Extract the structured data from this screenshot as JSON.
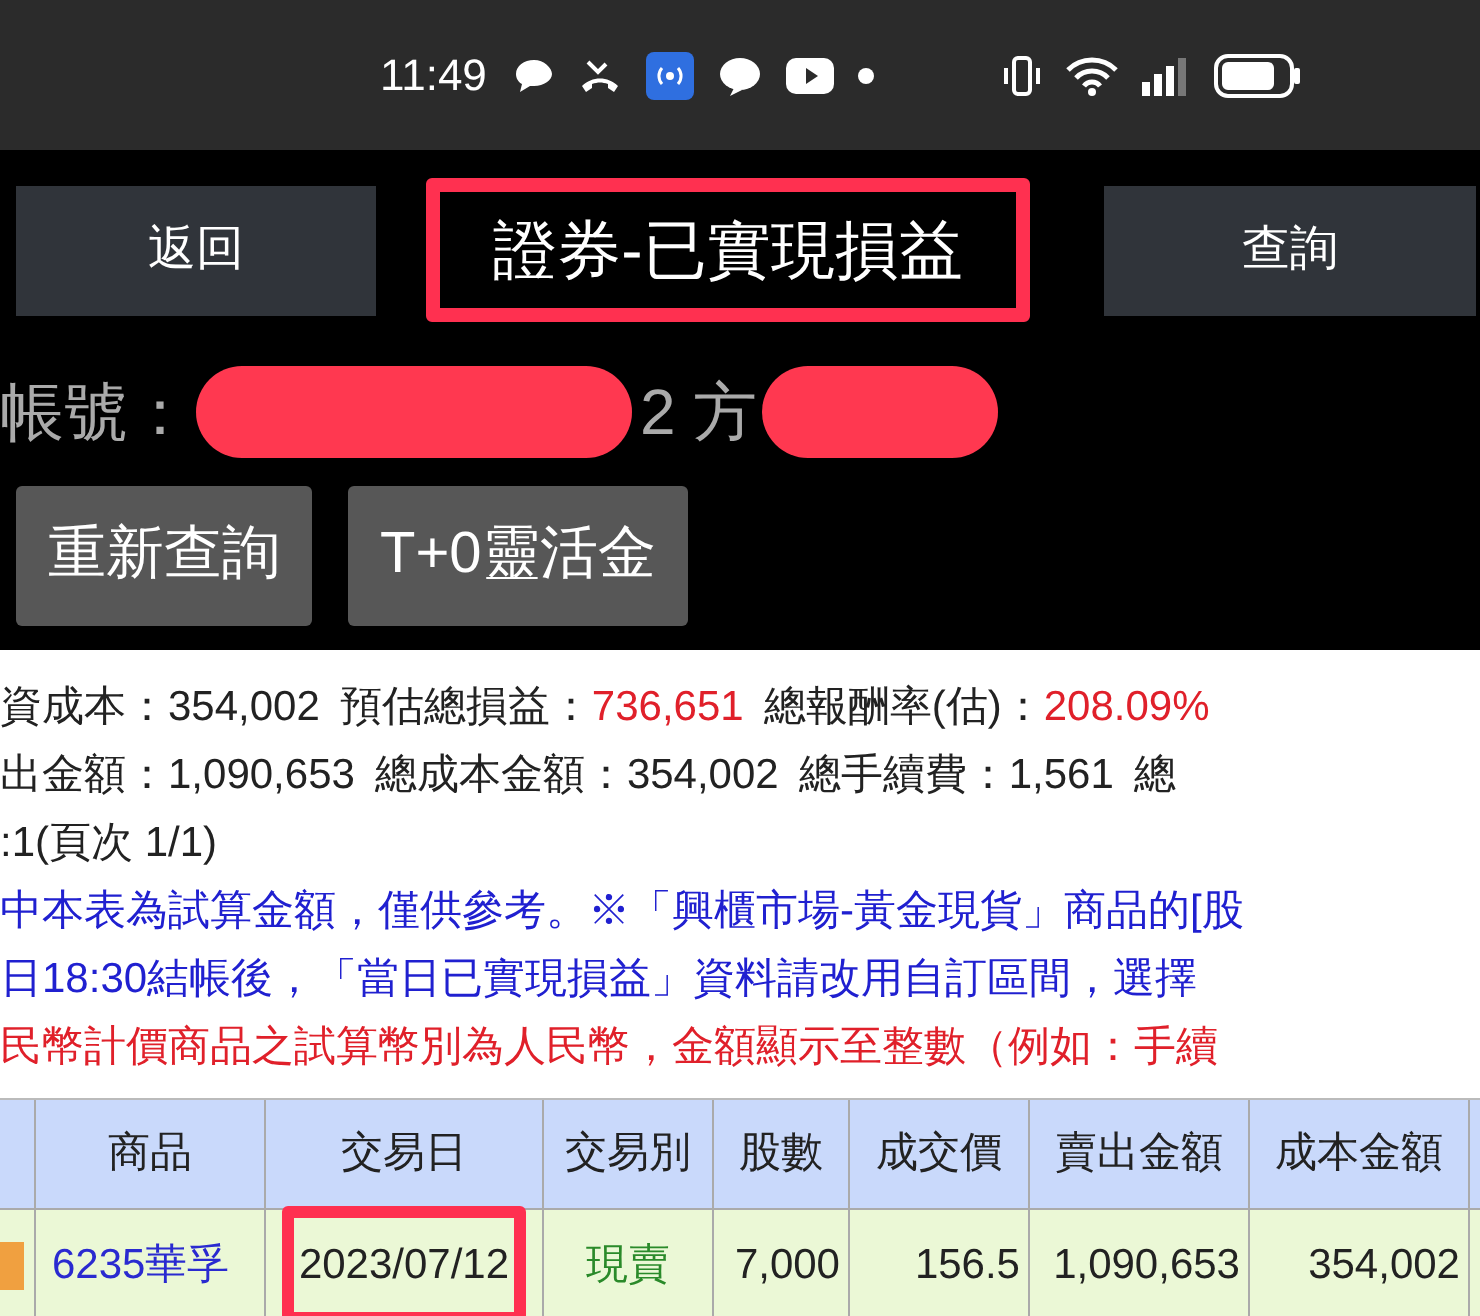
{
  "status_bar": {
    "time": "11:49"
  },
  "header": {
    "back_button": "返回",
    "title": "證券-已實現損益",
    "title_highlighted": true,
    "query_button": "查詢"
  },
  "account": {
    "label": "帳號：",
    "visible_fragment": "2 方",
    "redacted": true
  },
  "actions": [
    "重新查詢",
    "T+0靈活金"
  ],
  "summary_lines": [
    [
      {
        "text": "資成本：",
        "alert": false
      },
      {
        "text": "354,002",
        "alert": false
      },
      {
        "text": "預估總損益：",
        "alert": false
      },
      {
        "text": "736,651",
        "alert": true
      },
      {
        "text": "總報酬率(估)：",
        "alert": false
      },
      {
        "text": "208.09%",
        "alert": true
      }
    ],
    [
      {
        "text": "出金額：",
        "alert": false
      },
      {
        "text": "1,090,653",
        "alert": false
      },
      {
        "text": "總成本金額：",
        "alert": false
      },
      {
        "text": "354,002",
        "alert": false
      },
      {
        "text": "總手續費：",
        "alert": false
      },
      {
        "text": "1,561",
        "alert": false
      },
      {
        "text": "總",
        "alert": false
      }
    ],
    [
      {
        "text": ":1(頁次 1/1)",
        "alert": false
      }
    ]
  ],
  "notes": [
    {
      "text": "中本表為試算金額，僅供參考。※「興櫃市場-黃金現貨」商品的[股",
      "color": "#2020d0"
    },
    {
      "text": "日18:30結帳後，「當日已實現損益」資料請改用自訂區間，選擇",
      "color": "#2020d0"
    },
    {
      "text": "民幣計價商品之試算幣別為人民幣，金額顯示至整數（例如：手續",
      "color": "#e0202a"
    }
  ],
  "table": {
    "columns": [
      "商品",
      "交易日",
      "交易別",
      "股數",
      "成交價",
      "賣出金額",
      "成本金額"
    ],
    "rows": [
      {
        "cells": [
          "6235華孚",
          "2023/07/12",
          "現賣",
          "7,000",
          "156.5",
          "1,090,653",
          "354,002"
        ],
        "date_highlighted": true
      }
    ]
  }
}
